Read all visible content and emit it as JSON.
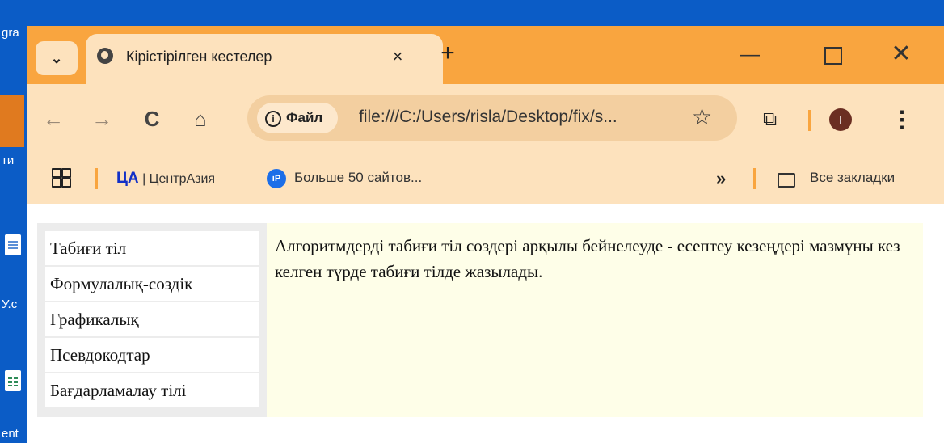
{
  "desktop": {
    "labels": [
      "gra",
      "ти",
      "У.с",
      "ent"
    ]
  },
  "browser": {
    "tab": {
      "title": "Кірістірілген кестелер",
      "close": "×"
    },
    "new_tab": "+",
    "window_controls": {
      "minimize": "—",
      "close": "✕"
    },
    "toolbar": {
      "back": "←",
      "forward": "→",
      "reload": "C",
      "home": "⌂",
      "site_chip": "Файл",
      "url": "file:///C:/Users/risla/Desktop/fix/s...",
      "star": "☆",
      "profile_initial": "I",
      "menu": "⋮"
    },
    "bookmarks": {
      "item1_logo": "ЦА",
      "item1_label": "| ЦентрАзия",
      "item2_icon": "iP",
      "item2_label": "Больше 50 сайтов...",
      "overflow": "»",
      "all_bookmarks": "Все закладки"
    }
  },
  "page": {
    "menu": [
      "Табиғи тіл",
      "Формулалық-сөздік",
      "Графикалық",
      "Псевдокодтар",
      "Бағдарламалау тілі"
    ],
    "description": "Алгоритмдерді табиғи тіл сөздері арқылы бейнелеуде - есептеу кезеңдері мазмұны кез келген түрде табиғи тілде жазылады."
  },
  "colors": {
    "titlebar": "#f9a53f",
    "toolbar": "#fde2bd",
    "menu_panel": "#ececec",
    "text_cell": "#fefee8"
  }
}
